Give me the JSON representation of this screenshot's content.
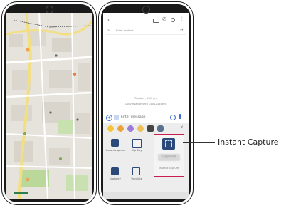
{
  "callout": {
    "label": "Instant Capture"
  },
  "messaging": {
    "to_placeholder": "Enter contact",
    "date_divider": "Tuesday, 1:49 pm",
    "conversation_note": "Conversation with 01012345678",
    "input_placeholder": "Enter message"
  },
  "quick_tools": [
    {
      "label": "Instant capture",
      "icon": "scissors-icon"
    },
    {
      "label": "Clip Tray",
      "icon": "clipboard-icon"
    },
    {
      "label": "Capture+",
      "icon": "capture-plus-icon"
    },
    {
      "label": "Translate",
      "icon": "translate-icon"
    },
    {
      "label": "Sketch",
      "icon": "sketch-icon"
    }
  ],
  "selected_tile": {
    "label": "Instant capture",
    "caption": "Capture"
  },
  "colors": {
    "accent": "#c61e4d",
    "dark": "#1a1a1a",
    "map_green": "#b9d89a"
  }
}
